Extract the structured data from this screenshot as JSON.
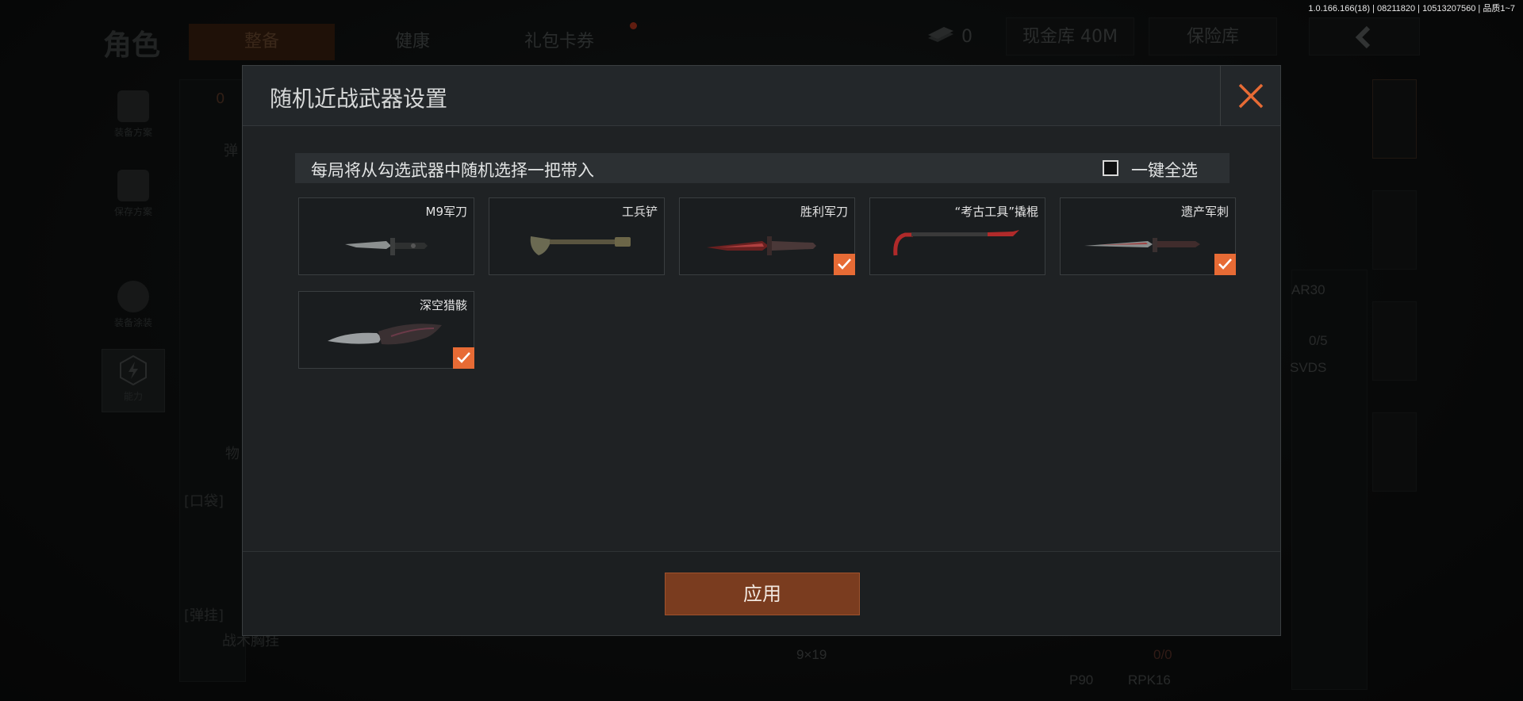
{
  "version_text": "1.0.166.166(18) | 08211820 | 10513207560 | 品质1~7",
  "background": {
    "title": "角色",
    "tabs": [
      {
        "label": "整备",
        "active": true
      },
      {
        "label": "健康",
        "active": false
      },
      {
        "label": "礼包卡券",
        "active": false,
        "badge_dot": true
      }
    ],
    "cash_item_count": "0",
    "cash_vault": "现金库 40M",
    "safe_box": "保险库",
    "rail_items": [
      {
        "label": "装备方案",
        "icon": "backpack-icon"
      },
      {
        "label": "保存方案",
        "icon": "download-icon"
      },
      {
        "label": "装备涂装",
        "icon": "helmet-icon"
      },
      {
        "label": "能力",
        "icon": "lightning-icon",
        "selected": true
      }
    ],
    "labels": {
      "zero": "0",
      "ammo_tab": "弹",
      "items_tab": "物",
      "pocket": "[口袋]",
      "rig": "[弹挂]",
      "rig_item": "战术胸挂",
      "ar": "AR30",
      "ar_count": "0/5",
      "svds": "SVDS",
      "caliber": "9×19",
      "caliber_count": "0/0",
      "p90": "P90",
      "rpk": "RPK16"
    }
  },
  "modal": {
    "title": "随机近战武器设置",
    "info_text": "每局将从勾选武器中随机选择一把带入",
    "select_all_label": "一键全选",
    "select_all_checked": false,
    "apply_label": "应用",
    "accent_color": "#e76b35",
    "weapons": [
      {
        "name": "M9军刀",
        "checked": false,
        "icon": "m9-knife-icon"
      },
      {
        "name": "工兵铲",
        "checked": false,
        "icon": "shovel-icon"
      },
      {
        "name": "胜利军刀",
        "checked": true,
        "icon": "victory-knife-icon"
      },
      {
        "name": "“考古工具”撬棍",
        "checked": false,
        "icon": "crowbar-icon"
      },
      {
        "name": "遗产军刺",
        "checked": true,
        "icon": "bayonet-icon"
      },
      {
        "name": "深空猎骸",
        "checked": true,
        "icon": "karambit-knife-icon"
      }
    ]
  }
}
